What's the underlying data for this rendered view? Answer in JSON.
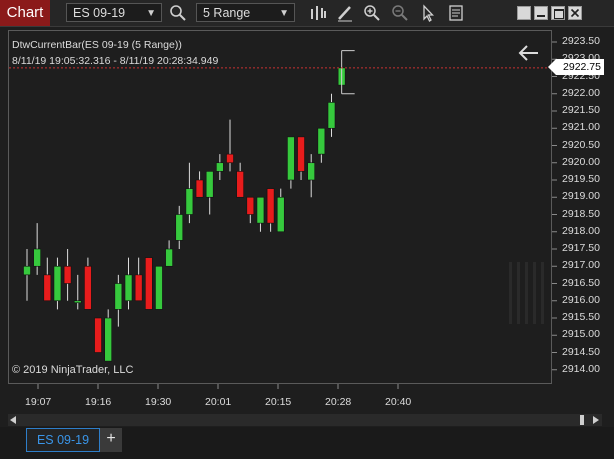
{
  "toolbar": {
    "chart_label": "Chart",
    "instrument": "ES 09-19",
    "interval": "5 Range",
    "icons": [
      "search-icon",
      "bar-type-icon",
      "drawing-tool-icon",
      "zoom-in-icon",
      "zoom-out-icon",
      "pointer-icon",
      "properties-icon"
    ]
  },
  "window_controls": [
    "tile-icon",
    "minimize-icon",
    "maximize-icon",
    "close-icon"
  ],
  "chart": {
    "indicator_label": "DtwCurrentBar(ES 09-19 (5 Range))",
    "time_range": "8/11/19 19:05:32.316 - 8/11/19 20:28:34.949",
    "copyright": "© 2019 NinjaTrader, LLC",
    "current_price": "2922.75",
    "colors": {
      "up": "#36c93d",
      "down": "#e81c1c",
      "background": "#1e1e1e",
      "price_line": "#c83232"
    }
  },
  "tabs": {
    "active": "ES 09-19",
    "add": "+"
  },
  "chart_data": {
    "type": "candlestick",
    "ylim": [
      2913.75,
      2923.75
    ],
    "y_ticks": [
      "2923.50",
      "2923.00",
      "2922.50",
      "2922.00",
      "2921.50",
      "2921.00",
      "2920.50",
      "2920.00",
      "2919.50",
      "2919.00",
      "2918.50",
      "2918.00",
      "2917.50",
      "2917.00",
      "2916.50",
      "2916.00",
      "2915.50",
      "2915.00",
      "2914.50",
      "2914.00"
    ],
    "x_ticks": [
      "19:07",
      "19:16",
      "19:30",
      "20:01",
      "20:15",
      "20:28",
      "20:40"
    ],
    "candles": [
      {
        "o": 2916.75,
        "h": 2917.5,
        "l": 2916.0,
        "c": 2917.0
      },
      {
        "o": 2917.0,
        "h": 2918.25,
        "l": 2916.75,
        "c": 2917.5
      },
      {
        "o": 2916.75,
        "h": 2917.25,
        "l": 2916.0,
        "c": 2916.0
      },
      {
        "o": 2916.0,
        "h": 2917.25,
        "l": 2915.75,
        "c": 2917.0
      },
      {
        "o": 2917.0,
        "h": 2917.5,
        "l": 2916.0,
        "c": 2916.5
      },
      {
        "o": 2916.0,
        "h": 2916.75,
        "l": 2915.75,
        "c": 2916.0
      },
      {
        "o": 2917.0,
        "h": 2917.25,
        "l": 2915.75,
        "c": 2915.75
      },
      {
        "o": 2915.5,
        "h": 2915.5,
        "l": 2914.5,
        "c": 2914.5
      },
      {
        "o": 2914.25,
        "h": 2915.75,
        "l": 2914.25,
        "c": 2915.5
      },
      {
        "o": 2915.75,
        "h": 2916.75,
        "l": 2915.25,
        "c": 2916.5
      },
      {
        "o": 2916.0,
        "h": 2917.25,
        "l": 2915.75,
        "c": 2916.75
      },
      {
        "o": 2916.75,
        "h": 2917.25,
        "l": 2916.0,
        "c": 2916.0
      },
      {
        "o": 2917.25,
        "h": 2917.25,
        "l": 2915.75,
        "c": 2915.75
      },
      {
        "o": 2915.75,
        "h": 2917.0,
        "l": 2915.75,
        "c": 2917.0
      },
      {
        "o": 2917.0,
        "h": 2917.75,
        "l": 2917.0,
        "c": 2917.5
      },
      {
        "o": 2917.75,
        "h": 2918.75,
        "l": 2917.5,
        "c": 2918.5
      },
      {
        "o": 2918.5,
        "h": 2920.0,
        "l": 2918.25,
        "c": 2919.25
      },
      {
        "o": 2919.5,
        "h": 2919.75,
        "l": 2919.0,
        "c": 2919.0
      },
      {
        "o": 2919.0,
        "h": 2919.75,
        "l": 2918.5,
        "c": 2919.75
      },
      {
        "o": 2919.75,
        "h": 2920.25,
        "l": 2919.5,
        "c": 2920.0
      },
      {
        "o": 2920.25,
        "h": 2921.25,
        "l": 2919.75,
        "c": 2920.0
      },
      {
        "o": 2919.75,
        "h": 2920.0,
        "l": 2919.0,
        "c": 2919.0
      },
      {
        "o": 2919.0,
        "h": 2919.0,
        "l": 2918.25,
        "c": 2918.5
      },
      {
        "o": 2918.25,
        "h": 2919.0,
        "l": 2918.0,
        "c": 2919.0
      },
      {
        "o": 2919.25,
        "h": 2919.25,
        "l": 2918.0,
        "c": 2918.25
      },
      {
        "o": 2918.0,
        "h": 2919.25,
        "l": 2918.0,
        "c": 2919.0
      },
      {
        "o": 2919.5,
        "h": 2920.75,
        "l": 2919.25,
        "c": 2920.75
      },
      {
        "o": 2920.75,
        "h": 2920.75,
        "l": 2919.5,
        "c": 2919.75
      },
      {
        "o": 2919.5,
        "h": 2920.25,
        "l": 2919.0,
        "c": 2920.0
      },
      {
        "o": 2920.25,
        "h": 2921.0,
        "l": 2920.0,
        "c": 2921.0
      },
      {
        "o": 2921.0,
        "h": 2922.0,
        "l": 2920.75,
        "c": 2921.75
      },
      {
        "o": 2922.25,
        "h": 2922.75,
        "l": 2922.25,
        "c": 2922.75
      }
    ]
  }
}
